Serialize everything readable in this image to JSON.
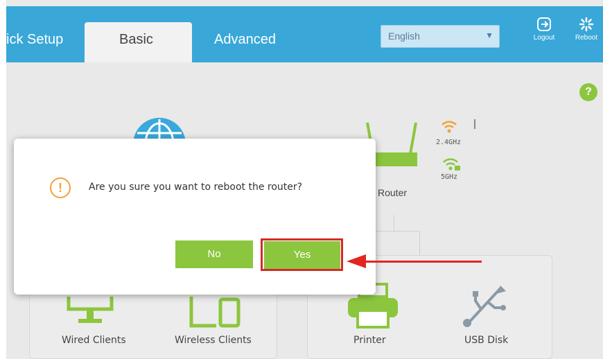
{
  "header": {
    "tabs": [
      {
        "label": "ick Setup"
      },
      {
        "label": "Basic",
        "active": true
      },
      {
        "label": "Advanced"
      }
    ],
    "language": {
      "selected": "English"
    },
    "logout_label": "Logout",
    "reboot_label": "Reboot"
  },
  "help_label": "?",
  "network_map": {
    "router_label": "Router",
    "band_24": "2.4GHz",
    "band_5": "5GHz",
    "clients": {
      "wired": "Wired Clients",
      "wireless": "Wireless Clients",
      "printer": "Printer",
      "usb": "USB Disk"
    }
  },
  "dialog": {
    "icon": "warning-icon",
    "warning_glyph": "!",
    "message": "Are you sure you want to reboot the router?",
    "no_label": "No",
    "yes_label": "Yes"
  },
  "colors": {
    "header": "#39a7d8",
    "green": "#8cc63e",
    "highlight": "#d42a27",
    "warning": "#f0a23a"
  }
}
